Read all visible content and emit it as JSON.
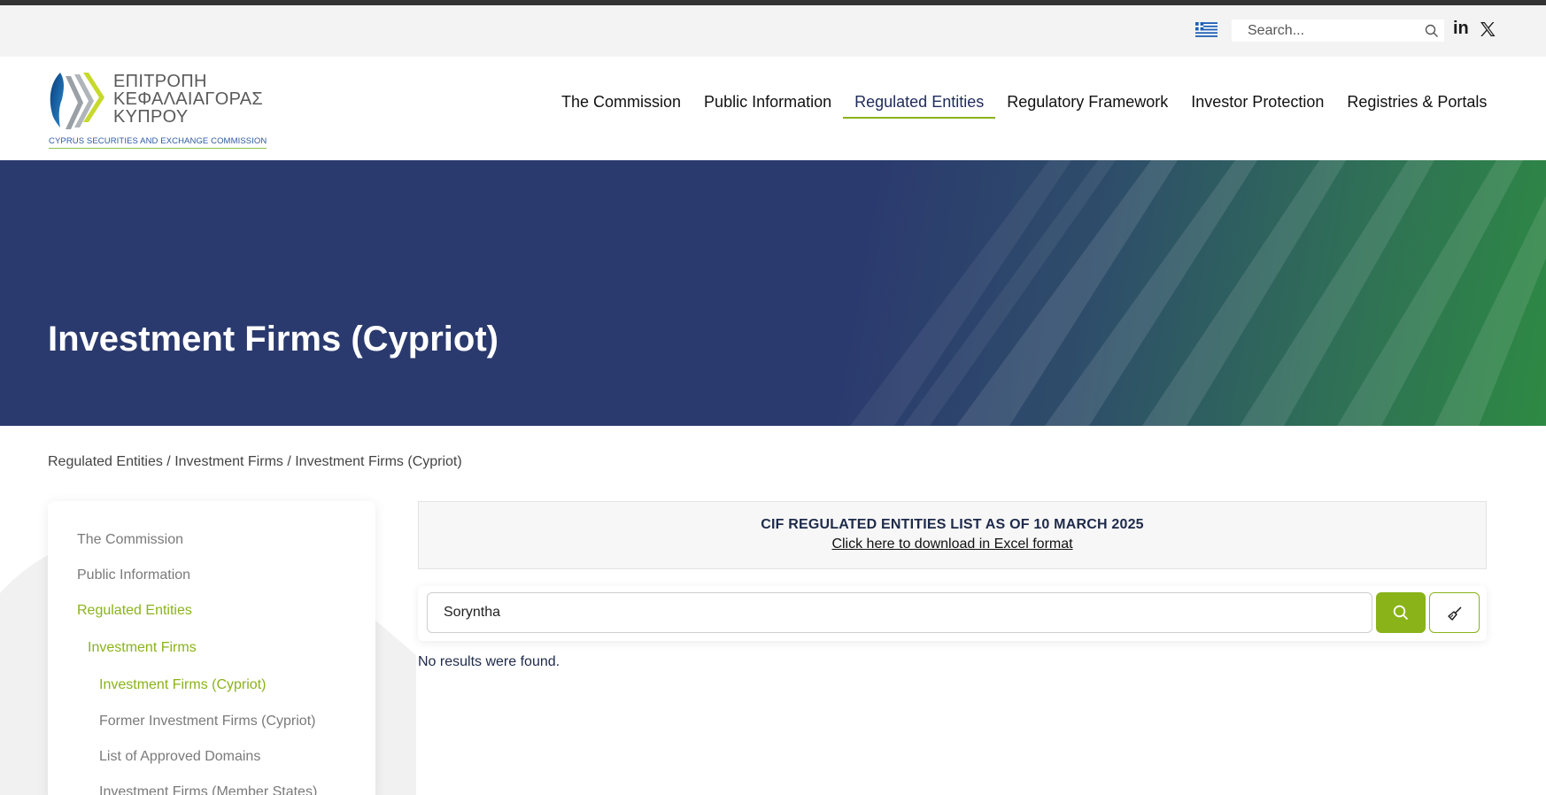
{
  "utility": {
    "search_placeholder": "Search...",
    "flag_icon": "greece-flag-icon",
    "search_icon": "search-icon",
    "social": [
      {
        "name": "linkedin-icon",
        "label": "in"
      },
      {
        "name": "x-twitter-icon",
        "label": ""
      }
    ]
  },
  "logo": {
    "line1": "ΕΠΙΤΡΟΠΗ",
    "line2": "ΚΕΦΑΛΑΙΑΓΟΡΑΣ",
    "line3": "ΚΥΠΡΟΥ",
    "subtitle": "CYPRUS SECURITIES AND EXCHANGE COMMISSION"
  },
  "nav": {
    "items": [
      {
        "label": "The Commission"
      },
      {
        "label": "Public Information"
      },
      {
        "label": "Regulated Entities",
        "active": true
      },
      {
        "label": "Regulatory Framework"
      },
      {
        "label": "Investor Protection"
      },
      {
        "label": "Registries & Portals"
      }
    ]
  },
  "hero": {
    "title": "Investment Firms (Cypriot)"
  },
  "breadcrumb": {
    "items": [
      "Regulated Entities",
      "Investment Firms",
      "Investment Firms (Cypriot)"
    ],
    "separator": " / "
  },
  "sidebar": {
    "items": [
      {
        "label": "The Commission",
        "level": 1
      },
      {
        "label": "Public Information",
        "level": 1
      },
      {
        "label": "Regulated Entities",
        "level": 1,
        "active": true
      },
      {
        "label": "Investment Firms",
        "level": 2,
        "active": true
      },
      {
        "label": "Investment Firms (Cypriot)",
        "level": 3,
        "active": true
      },
      {
        "label": "Former Investment Firms (Cypriot)",
        "level": 3
      },
      {
        "label": "List of Approved Domains",
        "level": 3
      },
      {
        "label": "Investment Firms (Member States)",
        "level": 3
      }
    ]
  },
  "notice": {
    "title": "CIF REGULATED ENTITIES LIST AS OF 10 MARCH 2025",
    "link": "Click here to download in Excel format"
  },
  "search": {
    "value": "Soryntha",
    "search_icon": "search-icon",
    "clear_icon": "broom-icon"
  },
  "results": {
    "message": "No results were found."
  },
  "colors": {
    "accent": "#8ab31a",
    "hero_blue": "#2b3a6e",
    "hero_green": "#2e8a43"
  }
}
